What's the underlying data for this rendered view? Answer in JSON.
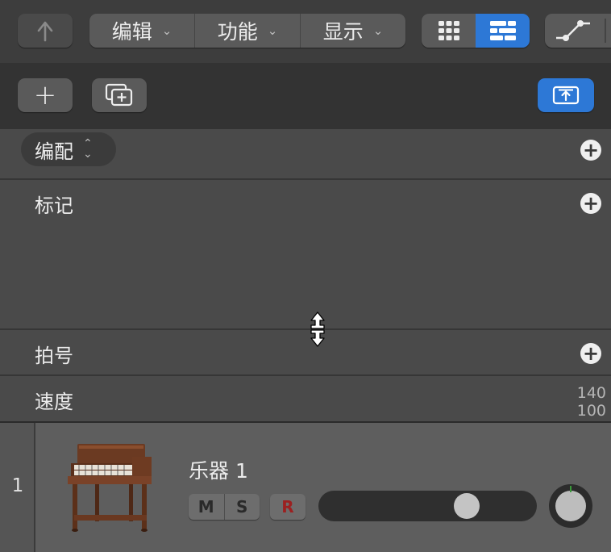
{
  "toolbar": {
    "back_icon": "back-arrow-icon",
    "menus": [
      {
        "label": "编辑"
      },
      {
        "label": "功能"
      },
      {
        "label": "显示"
      }
    ],
    "view_grid_icon": "grid-view-icon",
    "view_list_icon": "tracks-view-icon",
    "automation_icon": "automation-icon",
    "accent_color": "#2d78d6"
  },
  "toolbar2": {
    "add_label": "+",
    "duplicate_icon": "duplicate-track-icon",
    "upload_icon": "upload-icon"
  },
  "global_tracks": {
    "arrangement": {
      "label": "编配"
    },
    "marker": {
      "label": "标记"
    },
    "signature": {
      "label": "拍号"
    },
    "tempo": {
      "label": "速度",
      "top_value": "140",
      "bottom_value": "100"
    }
  },
  "track": {
    "number": "1",
    "name": "乐器 1",
    "mute_label": "M",
    "solo_label": "S",
    "record_label": "R",
    "volume_level": 0.71,
    "instrument_icon": "organ-icon"
  }
}
